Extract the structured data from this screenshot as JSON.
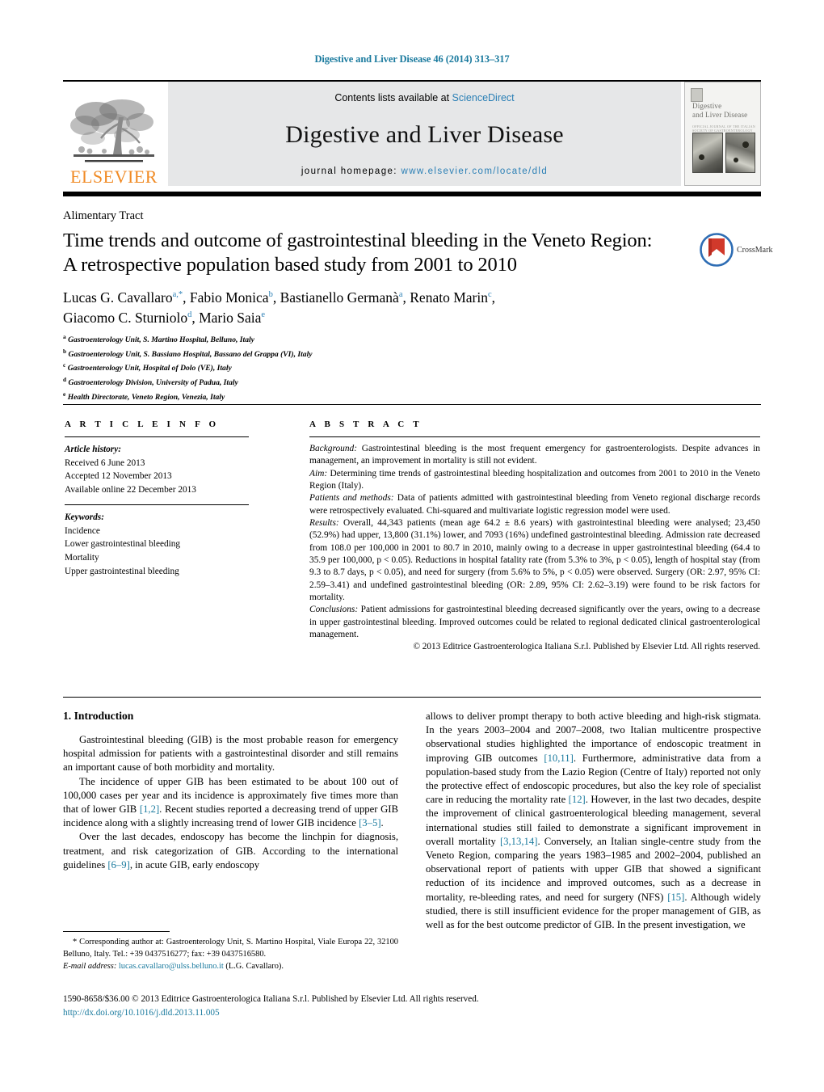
{
  "running_head": "Digestive and Liver Disease 46 (2014) 313–317",
  "masthead": {
    "publisher_name": "ELSEVIER",
    "contents_prefix": "Contents lists available at ",
    "contents_link": "ScienceDirect",
    "journal_title": "Digestive and Liver Disease",
    "homepage_prefix": "journal homepage: ",
    "homepage_url": "www.elsevier.com/locate/dld",
    "cover": {
      "title_line1": "Digestive",
      "title_line2": "and Liver Disease",
      "subtitle": "OFFICIAL JOURNAL OF THE ITALIAN SOCIETY OF GASTROENTEROLOGY"
    }
  },
  "article": {
    "section_label": "Alimentary Tract",
    "title": "Time trends and outcome of gastrointestinal bleeding in the Veneto Region: A retrospective population based study from 2001 to 2010",
    "crossmark_label": "CrossMark",
    "authors_line1": "Lucas G. Cavallaro",
    "authors_line2": "Giacomo C. Sturniolo",
    "authors": [
      {
        "name": "Lucas G. Cavallaro",
        "marks": "a,*"
      },
      {
        "name": "Fabio Monica",
        "marks": "b"
      },
      {
        "name": "Bastianello Germanà",
        "marks": "a"
      },
      {
        "name": "Renato Marin",
        "marks": "c"
      },
      {
        "name": "Giacomo C. Sturniolo",
        "marks": "d"
      },
      {
        "name": "Mario Saia",
        "marks": "e"
      }
    ],
    "affiliations": [
      {
        "mark": "a",
        "text": "Gastroenterology Unit, S. Martino Hospital, Belluno, Italy"
      },
      {
        "mark": "b",
        "text": "Gastroenterology Unit, S. Bassiano Hospital, Bassano del Grappa (VI), Italy"
      },
      {
        "mark": "c",
        "text": "Gastroenterology Unit, Hospital of Dolo (VE), Italy"
      },
      {
        "mark": "d",
        "text": "Gastroenterology Division, University of Padua, Italy"
      },
      {
        "mark": "e",
        "text": "Health Directorate, Veneto Region, Venezia, Italy"
      }
    ]
  },
  "article_info": {
    "heading": "A R T I C L E   I N F O",
    "history_label": "Article history:",
    "history": [
      "Received 6 June 2013",
      "Accepted 12 November 2013",
      "Available online 22 December 2013"
    ],
    "keywords_label": "Keywords:",
    "keywords": [
      "Incidence",
      "Lower gastrointestinal bleeding",
      "Mortality",
      "Upper gastrointestinal bleeding"
    ]
  },
  "abstract": {
    "heading": "A B S T R A C T",
    "background_label": "Background:",
    "background_text": " Gastrointestinal bleeding is the most frequent emergency for gastroenterologists. Despite advances in management, an improvement in mortality is still not evident.",
    "aim_label": "Aim:",
    "aim_text": " Determining time trends of gastrointestinal bleeding hospitalization and outcomes from 2001 to 2010 in the Veneto Region (Italy).",
    "methods_label": "Patients and methods:",
    "methods_text": " Data of patients admitted with gastrointestinal bleeding from Veneto regional discharge records were retrospectively evaluated. Chi-squared and multivariate logistic regression model were used.",
    "results_label": "Results:",
    "results_text": " Overall, 44,343 patients (mean age 64.2 ± 8.6 years) with gastrointestinal bleeding were analysed; 23,450 (52.9%) had upper, 13,800 (31.1%) lower, and 7093 (16%) undefined gastrointestinal bleeding. Admission rate decreased from 108.0 per 100,000 in 2001 to 80.7 in 2010, mainly owing to a decrease in upper gastrointestinal bleeding (64.4 to 35.9 per 100,000, p < 0.05). Reductions in hospital fatality rate (from 5.3% to 3%, p < 0.05), length of hospital stay (from 9.3 to 8.7 days, p < 0.05), and need for surgery (from 5.6% to 5%, p < 0.05) were observed. Surgery (OR: 2.97, 95% CI: 2.59–3.41) and undefined gastrointestinal bleeding (OR: 2.89, 95% CI: 2.62–3.19) were found to be risk factors for mortality.",
    "conclusions_label": "Conclusions:",
    "conclusions_text": " Patient admissions for gastrointestinal bleeding decreased significantly over the years, owing to a decrease in upper gastrointestinal bleeding. Improved outcomes could be related to regional dedicated clinical gastroenterological management.",
    "copyright": "© 2013 Editrice Gastroenterologica Italiana S.r.l. Published by Elsevier Ltd. All rights reserved."
  },
  "body": {
    "intro_heading": "1. Introduction",
    "left_paragraphs": [
      "Gastrointestinal bleeding (GIB) is the most probable reason for emergency hospital admission for patients with a gastrointestinal disorder and still remains an important cause of both morbidity and mortality.",
      "The incidence of upper GIB has been estimated to be about 100 out of 100,000 cases per year and its incidence is approximately five times more than that of lower GIB [1,2]. Recent studies reported a decreasing trend of upper GIB incidence along with a slightly increasing trend of lower GIB incidence [3–5].",
      "Over the last decades, endoscopy has become the linchpin for diagnosis, treatment, and risk categorization of GIB. According to the international guidelines [6–9], in acute GIB, early endoscopy"
    ],
    "right_paragraphs": [
      "allows to deliver prompt therapy to both active bleeding and high-risk stigmata. In the years 2003–2004 and 2007–2008, two Italian multicentre prospective observational studies highlighted the importance of endoscopic treatment in improving GIB outcomes [10,11]. Furthermore, administrative data from a population-based study from the Lazio Region (Centre of Italy) reported not only the protective effect of endoscopic procedures, but also the key role of specialist care in reducing the mortality rate [12]. However, in the last two decades, despite the improvement of clinical gastroenterological bleeding management, several international studies still failed to demonstrate a significant improvement in overall mortality [3,13,14]. Conversely, an Italian single-centre study from the Veneto Region, comparing the years 1983–1985 and 2002–2004, published an observational report of patients with upper GIB that showed a significant reduction of its incidence and improved outcomes, such as a decrease in mortality, re-bleeding rates, and need for surgery (NFS) [15]. Although widely studied, there is still insufficient evidence for the proper management of GIB, as well as for the best outcome predictor of GIB. In the present investigation, we"
    ]
  },
  "footnote": {
    "marker": "*",
    "text": " Corresponding author at: Gastroenterology Unit, S. Martino Hospital, Viale Europa 22, 32100 Belluno, Italy. Tel.: +39 0437516277; fax: +39 0437516580.",
    "email_label": "E-mail address:",
    "email": "lucas.cavallaro@ulss.belluno.it",
    "email_suffix": " (L.G. Cavallaro)."
  },
  "footer": {
    "issn_line": "1590-8658/$36.00 © 2013 Editrice Gastroenterologica Italiana S.r.l. Published by Elsevier Ltd. All rights reserved.",
    "doi": "http://dx.doi.org/10.1016/j.dld.2013.11.005"
  },
  "colors": {
    "link_blue": "#2a7fb5",
    "ref_blue": "#1a7a9e",
    "elsevier_orange": "#f08a24",
    "banner_gray": "#e6e7e8",
    "crossmark_red": "#d1392b",
    "crossmark_blue": "#2e6db4"
  }
}
